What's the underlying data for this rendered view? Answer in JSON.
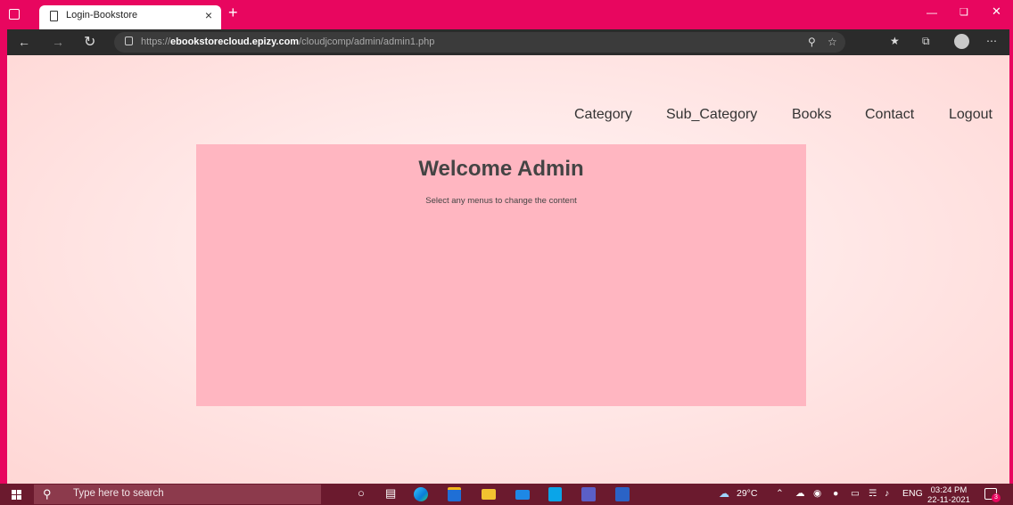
{
  "browser": {
    "tab_title": "Login-Bookstore",
    "tab_close": "×",
    "new_tab": "+",
    "url_prefix": "https://",
    "url_domain": "ebookstorecloud.epizy.com",
    "url_path": "/cloudjcomp/admin/admin1.php",
    "icons": [
      "window-menu-icon",
      "page-icon",
      "close-icon",
      "plus-icon",
      "back-icon",
      "forward-icon",
      "refresh-icon",
      "lock-icon",
      "key-icon",
      "favorite-add-icon",
      "favorites-icon",
      "collections-icon",
      "profile-icon",
      "more-icon",
      "minimize-icon",
      "restore-icon",
      "close-window-icon"
    ]
  },
  "site": {
    "nav": [
      "Category",
      "Sub_Category",
      "Books",
      "Contact",
      "Logout"
    ],
    "welcome_title": "Welcome Admin",
    "welcome_subtitle": "Select any menus to change the content"
  },
  "taskbar": {
    "search_placeholder": "Type here to search",
    "weather": "29°C",
    "language": "ENG",
    "time": "03:24 PM",
    "date": "22-11-2021",
    "notification_count": "3"
  },
  "colors": {
    "title_bar": "#e8065f",
    "panel": "#ffb6c1",
    "page_background": "#ffe5e4",
    "taskbar": "#6b1a2e"
  }
}
